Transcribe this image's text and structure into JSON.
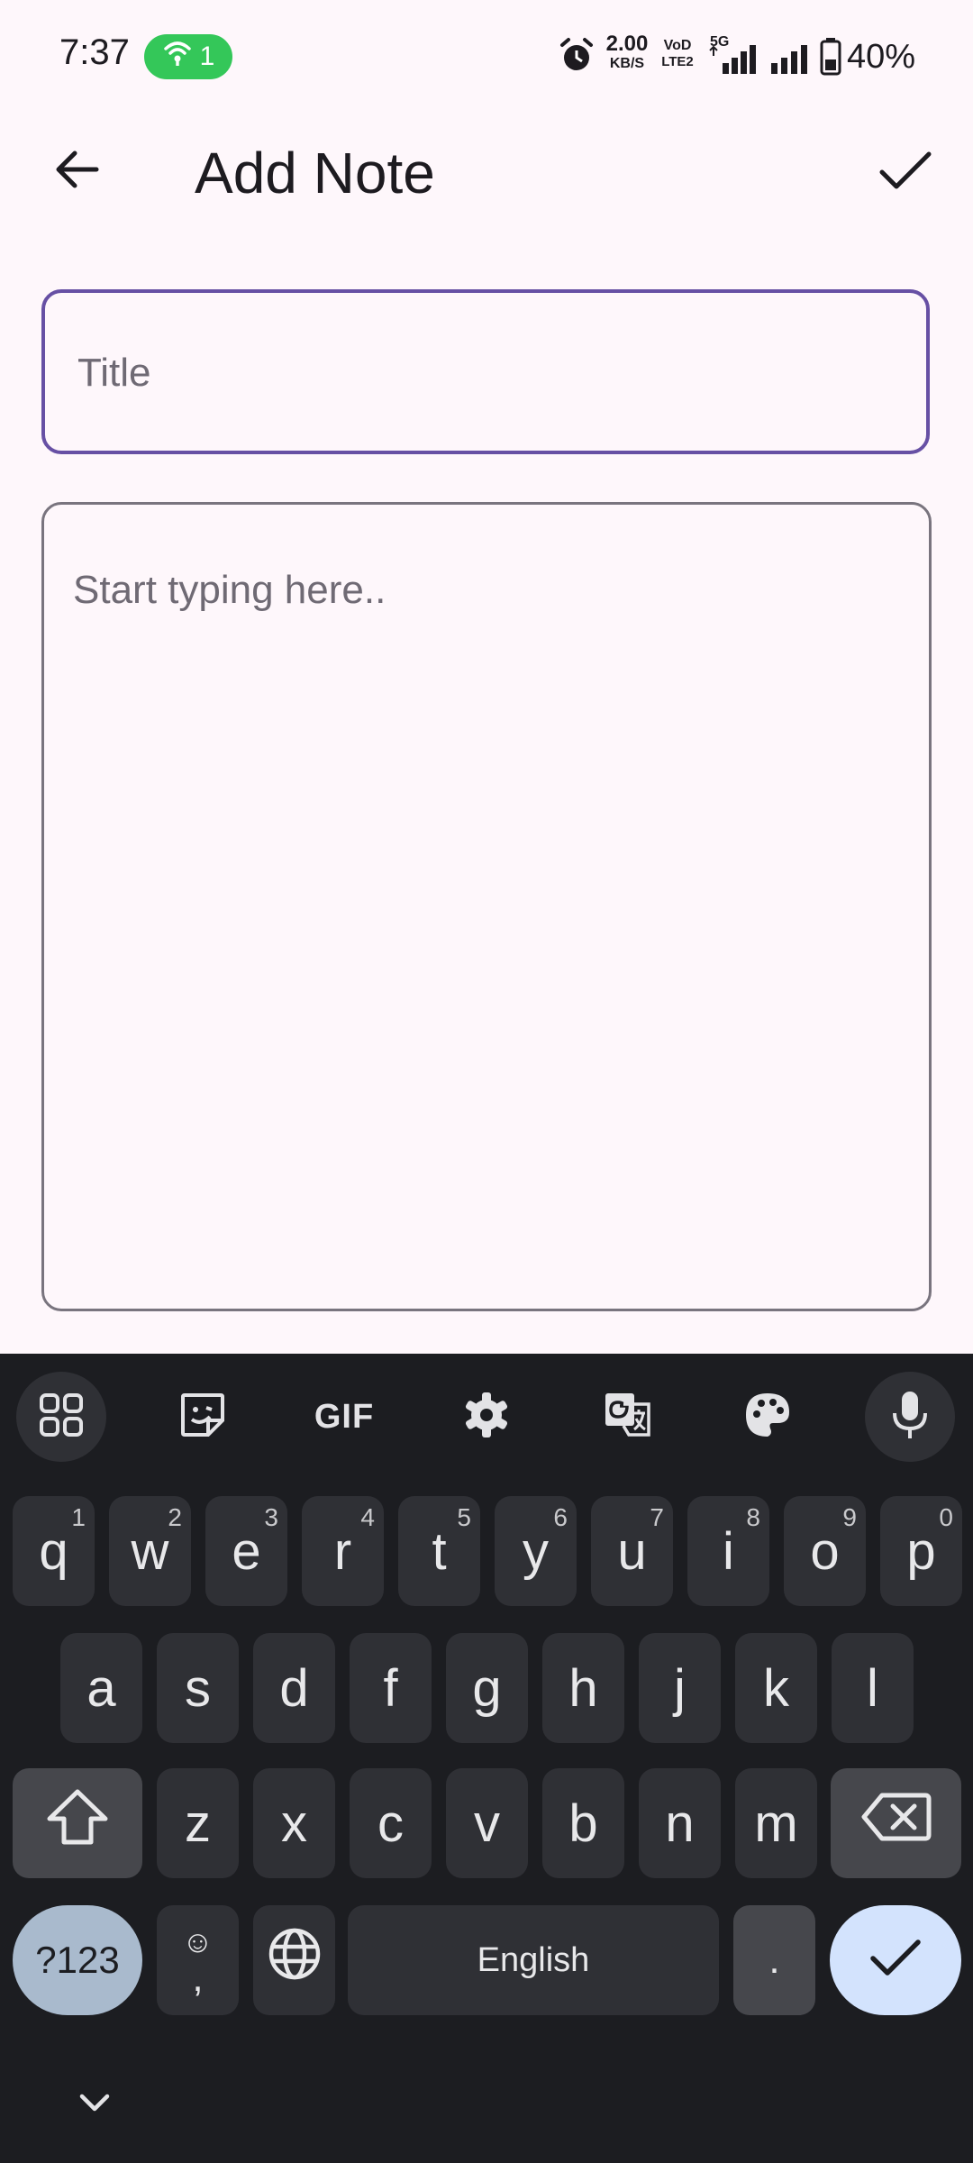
{
  "status_bar": {
    "time": "7:37",
    "hotspot_count": "1",
    "net_speed_value": "2.00",
    "net_speed_unit": "KB/S",
    "volte_top": "VoD",
    "volte_bottom": "LTE2",
    "network_type": "5G",
    "battery": "40%"
  },
  "app_bar": {
    "title": "Add Note"
  },
  "form": {
    "title_placeholder": "Title",
    "title_value": "",
    "body_placeholder": "Start typing here..",
    "body_value": ""
  },
  "keyboard": {
    "toolbar": {
      "gif_label": "GIF"
    },
    "row1": [
      {
        "key": "q",
        "hint": "1"
      },
      {
        "key": "w",
        "hint": "2"
      },
      {
        "key": "e",
        "hint": "3"
      },
      {
        "key": "r",
        "hint": "4"
      },
      {
        "key": "t",
        "hint": "5"
      },
      {
        "key": "y",
        "hint": "6"
      },
      {
        "key": "u",
        "hint": "7"
      },
      {
        "key": "i",
        "hint": "8"
      },
      {
        "key": "o",
        "hint": "9"
      },
      {
        "key": "p",
        "hint": "0"
      }
    ],
    "row2": [
      "a",
      "s",
      "d",
      "f",
      "g",
      "h",
      "j",
      "k",
      "l"
    ],
    "row3": [
      "z",
      "x",
      "c",
      "v",
      "b",
      "n",
      "m"
    ],
    "symbols_label": "?123",
    "emoji_key_top": "☺",
    "emoji_key_bottom": ",",
    "space_label": "English",
    "period_label": "."
  },
  "colors": {
    "accent": "#6750a4",
    "background": "#fef7fb",
    "keyboard_bg": "#1c1d21",
    "key_bg": "#2f3035",
    "hotspot_green": "#34c759"
  },
  "icons": {
    "back": "arrow-left-icon",
    "save": "check-icon",
    "apps": "grid-icon",
    "sticker": "sticker-icon",
    "settings": "gear-icon",
    "translate": "translate-icon",
    "theme": "palette-icon",
    "voice": "mic-icon",
    "shift": "shift-icon",
    "backspace": "backspace-icon",
    "language": "globe-icon",
    "enter": "check-icon",
    "collapse": "chevron-down-icon"
  }
}
